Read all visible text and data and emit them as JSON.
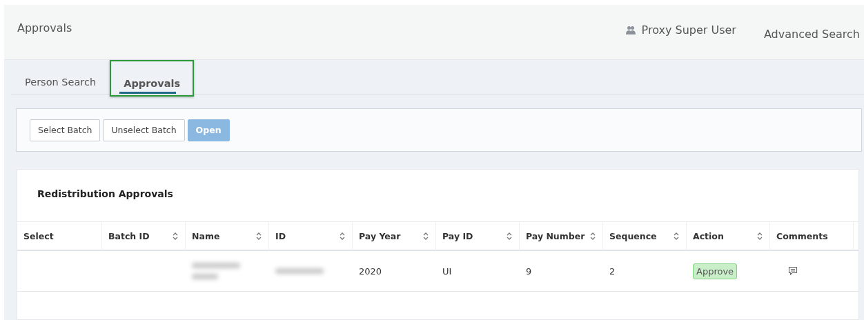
{
  "header": {
    "title": "Approvals",
    "user": "Proxy Super User",
    "link": "Advanced Search"
  },
  "tabs": [
    {
      "label": "Person Search",
      "selected": false
    },
    {
      "label": "Approvals",
      "selected": true
    }
  ],
  "toolbar": [
    {
      "label": "Select Batch",
      "disabled": false,
      "primary": false
    },
    {
      "label": "Unselect Batch",
      "disabled": false,
      "primary": false
    },
    {
      "label": "Open",
      "disabled": true,
      "primary": true
    }
  ],
  "card": {
    "title": "Redistribution Approvals",
    "table": {
      "columns": [
        {
          "label": "Select",
          "sortable": false
        },
        {
          "label": "Batch ID",
          "sortable": true
        },
        {
          "label": "Name",
          "sortable": true
        },
        {
          "label": "ID",
          "sortable": true
        },
        {
          "label": "Pay Year",
          "sortable": true
        },
        {
          "label": "Pay ID",
          "sortable": true
        },
        {
          "label": "Pay Number",
          "sortable": true
        },
        {
          "label": "Sequence",
          "sortable": true
        },
        {
          "label": "Action",
          "sortable": true
        },
        {
          "label": "Comments",
          "sortable": false
        }
      ],
      "rows": [
        {
          "cells": [
            {
              "kind": "empty"
            },
            {
              "kind": "empty"
            },
            {
              "kind": "redacted"
            },
            {
              "kind": "redacted"
            },
            {
              "kind": "text",
              "text": "2020"
            },
            {
              "kind": "text",
              "text": "UI"
            },
            {
              "kind": "text",
              "text": "9"
            },
            {
              "kind": "text",
              "text": "2"
            },
            {
              "kind": "button",
              "text": "Approve"
            },
            {
              "kind": "comment"
            }
          ]
        }
      ]
    }
  }
}
